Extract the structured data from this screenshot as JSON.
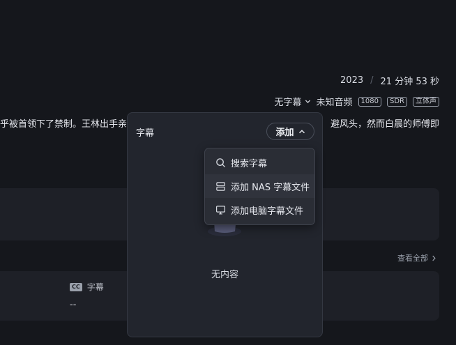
{
  "details": {
    "year": "2023",
    "duration": "21 分钟 53 秒",
    "subtitle_select": "无字幕",
    "audio": "未知音频",
    "badges": [
      "1080",
      "SDR",
      "立体声"
    ],
    "description_left": "乎被首领下了禁制。王林出手亲",
    "description_right": "避风头，然而白晨的师傅即"
  },
  "section": {
    "see_all": "查看全部",
    "subtitle_label": "字幕",
    "cc_icon_text": "CC",
    "subtitle_value": "--"
  },
  "panel": {
    "title": "字幕",
    "add_label": "添加",
    "empty_text": "无内容"
  },
  "menu": {
    "items": [
      {
        "label": "搜索字幕",
        "icon": "search-icon"
      },
      {
        "label": "添加 NAS 字幕文件",
        "icon": "server-icon"
      },
      {
        "label": "添加电脑字幕文件",
        "icon": "monitor-icon"
      }
    ]
  },
  "colors": {
    "background": "#15171c",
    "panel": "#22252d",
    "menu": "#2a2d35"
  }
}
